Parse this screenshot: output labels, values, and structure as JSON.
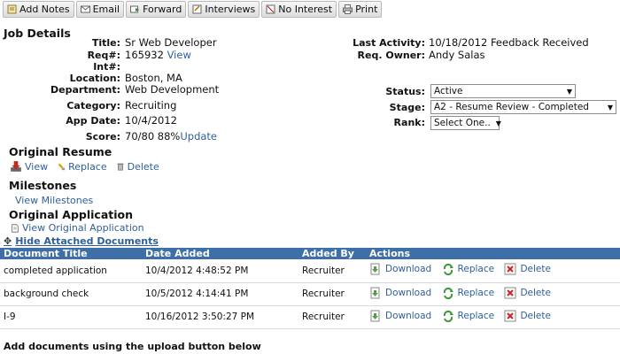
{
  "toolbar": {
    "buttons": [
      {
        "label": "Add Notes",
        "icon": "notes-icon"
      },
      {
        "label": "Email",
        "icon": "email-icon"
      },
      {
        "label": "Forward",
        "icon": "forward-icon"
      },
      {
        "label": "Interviews",
        "icon": "interviews-icon"
      },
      {
        "label": "No Interest",
        "icon": "no-interest-icon"
      },
      {
        "label": "Print",
        "icon": "print-icon"
      }
    ]
  },
  "job_details": {
    "heading": "Job Details",
    "title_label": "Title:",
    "title_value": "Sr Web Developer",
    "req_label": "Req#:",
    "req_value": "165932",
    "req_view": "View",
    "int_label": "Int#:",
    "location_label": "Location:",
    "location_value": "Boston, MA",
    "department_label": "Department:",
    "department_value": "Web Development",
    "category_label": "Category:",
    "category_value": "Recruiting",
    "app_date_label": "App Date:",
    "app_date_value": "10/4/2012",
    "score_label": "Score:",
    "score_value": "70/80 88%",
    "score_update": "Update"
  },
  "right_panel": {
    "last_activity_label": "Last Activity:",
    "last_activity_value": "10/18/2012 Feedback Received",
    "req_owner_label": "Req. Owner:",
    "req_owner_value": "Andy Salas",
    "status_label": "Status:",
    "status_value": "Active",
    "stage_label": "Stage:",
    "stage_value": "A2 - Resume Review - Completed",
    "rank_label": "Rank:",
    "rank_value": "Select One.."
  },
  "resume": {
    "heading": "Original Resume",
    "view": "View",
    "replace": "Replace",
    "delete": "Delete"
  },
  "milestones": {
    "heading": "Milestones",
    "link": "View Milestones"
  },
  "application": {
    "heading": "Original Application",
    "link": "View Original Application",
    "toggle": "Hide Attached Documents"
  },
  "documents": {
    "columns": [
      "Document Title",
      "Date Added",
      "Added By",
      "Actions"
    ],
    "actions": {
      "download": "Download",
      "replace": "Replace",
      "delete": "Delete"
    },
    "rows": [
      {
        "title": "completed application",
        "date": "10/4/2012 4:48:52 PM",
        "added_by": "Recruiter"
      },
      {
        "title": "background check",
        "date": "10/5/2012 4:14:41 PM",
        "added_by": "Recruiter"
      },
      {
        "title": "I-9",
        "date": "10/16/2012 3:50:27 PM",
        "added_by": "Recruiter"
      }
    ]
  },
  "footer": {
    "text": "Add documents using the upload button below"
  },
  "colors": {
    "table_header": "#3f6fa8",
    "link": "#2f5f99"
  }
}
